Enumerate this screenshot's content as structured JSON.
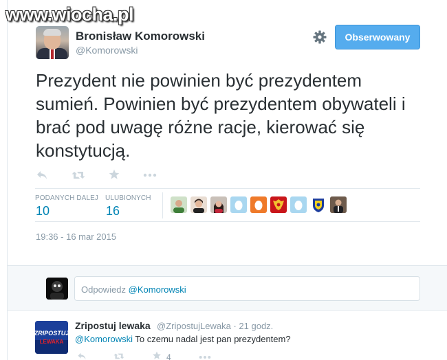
{
  "watermark": "www.wiocha.pl",
  "tweet": {
    "author_name": "Bronisław Komorowski",
    "author_handle": "@Komorowski",
    "follow_label": "Obserwowany",
    "text": "Prezydent nie powinien być prezydentem sumień. Powinien być prezydentem obywateli i brać pod uwagę różne racje, kierować się konstytucją.",
    "actions": [
      "reply-icon",
      "retweet-icon",
      "favorite-icon",
      "more-icon"
    ],
    "stats": {
      "retweets_label": "PODANYCH DALEJ",
      "retweets_value": "10",
      "favorites_label": "ULUBIONYCH",
      "favorites_value": "16"
    },
    "favorited_by_count": 10,
    "timestamp": "19:36 - 16 mar 2015"
  },
  "reply_box": {
    "placeholder_prefix": "Odpowiedz",
    "placeholder_mention": "@Komorowski"
  },
  "reply": {
    "author_name": "Zripostuj lewaka",
    "avatar_text_top": "ZRIPOSTUJ",
    "avatar_text_bottom": "LEWAKA",
    "meta": "@ZripostujLewaka · 21 godz.",
    "mention": "@Komorowski",
    "text": "To czemu nadal jest pan prezydentem?",
    "favorite_count": "4"
  },
  "colors": {
    "accent": "#55acee",
    "link": "#0084b4",
    "muted": "#8899a6",
    "icon": "#ccd6dd"
  }
}
